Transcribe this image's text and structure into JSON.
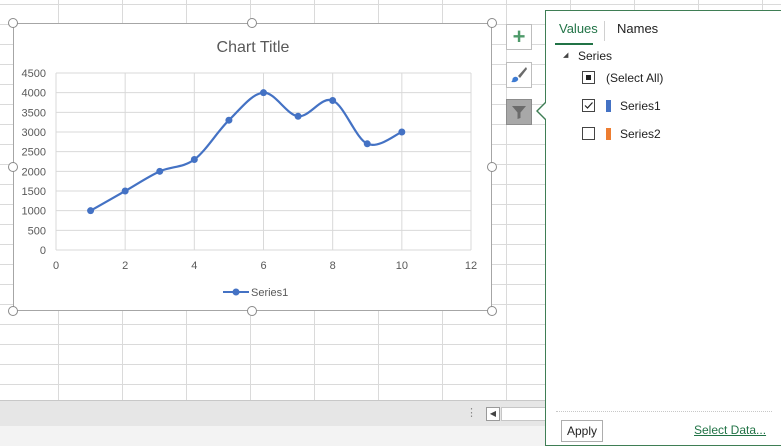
{
  "chart_data": {
    "type": "scatter",
    "title": "Chart Title",
    "xlim": [
      0,
      12
    ],
    "ylim": [
      0,
      4500
    ],
    "x_ticks": [
      "0",
      "2",
      "4",
      "6",
      "8",
      "10",
      "12"
    ],
    "y_ticks": [
      "0",
      "500",
      "1000",
      "1500",
      "2000",
      "2500",
      "3000",
      "3500",
      "4000",
      "4500"
    ],
    "grid": true,
    "smooth_lines": true,
    "legend_position": "bottom",
    "series": [
      {
        "name": "Series1",
        "color": "#4472c4",
        "x": [
          1,
          2,
          3,
          4,
          5,
          6,
          7,
          8,
          9,
          10
        ],
        "y": [
          1000,
          1500,
          2000,
          2300,
          3300,
          4000,
          3400,
          3800,
          2700,
          3000
        ]
      }
    ]
  },
  "side_buttons": {
    "chart_elements": "plus-icon",
    "chart_styles": "brush-icon",
    "chart_filters": "funnel-icon"
  },
  "filter_pane": {
    "tabs": [
      {
        "label": "Values",
        "active": true
      },
      {
        "label": "Names",
        "active": false
      }
    ],
    "group_label": "Series",
    "items": [
      {
        "label": "(Select All)",
        "state": "indeterminate"
      },
      {
        "label": "Series1",
        "state": "checked",
        "color": "#4472c4"
      },
      {
        "label": "Series2",
        "state": "unchecked",
        "color": "#ed7d31"
      }
    ],
    "apply_label": "Apply",
    "select_data_label": "Select Data..."
  },
  "status_bar": {
    "dots": "⋮",
    "scroll_left": "◀"
  }
}
